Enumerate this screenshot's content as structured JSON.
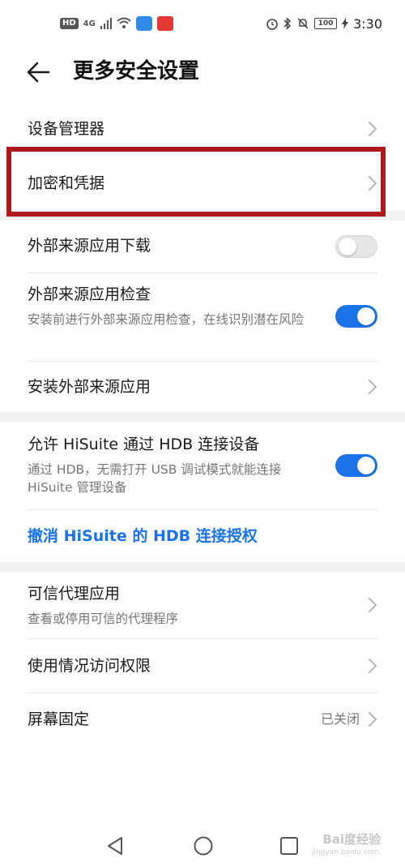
{
  "status_bar": {
    "hd": "HD",
    "network": "4G",
    "battery": "100",
    "time": "3:30"
  },
  "header": {
    "title": "更多安全设置"
  },
  "items": {
    "device_manager": {
      "title": "设备管理器"
    },
    "encryption": {
      "title": "加密和凭据"
    },
    "external_download": {
      "title": "外部来源应用下载",
      "enabled": false
    },
    "external_check": {
      "title": "外部来源应用检查",
      "subtitle": "安装前进行外部来源应用检查，在线识别潜在风险",
      "enabled": true
    },
    "install_external": {
      "title": "安装外部来源应用"
    },
    "hisuite_hdb": {
      "title": "允许 HiSuite 通过 HDB 连接设备",
      "subtitle": "通过 HDB，无需打开 USB 调试模式就能连接 HiSuite 管理设备",
      "enabled": true
    },
    "revoke_hdb": {
      "title": "撤消 HiSuite 的 HDB 连接授权"
    },
    "trust_agents": {
      "title": "可信代理应用",
      "subtitle": "查看或停用可信的代理程序"
    },
    "usage_access": {
      "title": "使用情况访问权限"
    },
    "screen_pinning": {
      "title": "屏幕固定",
      "value": "已关闭"
    }
  },
  "colors": {
    "accent": "#1a73e8",
    "highlight": "#b0191c"
  },
  "watermark": {
    "brand": "Bai度经验",
    "url": "jingyan.baidu.com"
  }
}
